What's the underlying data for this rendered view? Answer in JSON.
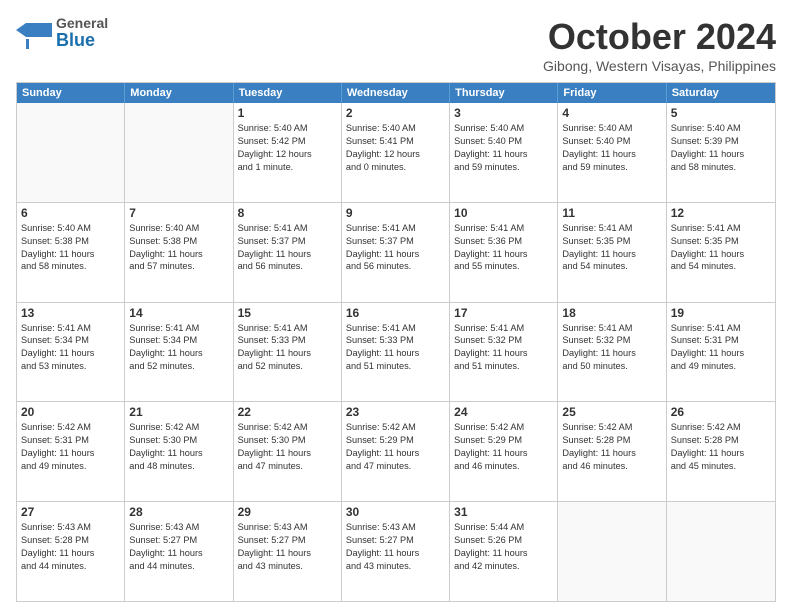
{
  "header": {
    "logo_general": "General",
    "logo_blue": "Blue",
    "month_title": "October 2024",
    "location": "Gibong, Western Visayas, Philippines"
  },
  "days_of_week": [
    "Sunday",
    "Monday",
    "Tuesday",
    "Wednesday",
    "Thursday",
    "Friday",
    "Saturday"
  ],
  "weeks": [
    [
      {
        "day": "",
        "lines": [],
        "empty": true
      },
      {
        "day": "",
        "lines": [],
        "empty": true
      },
      {
        "day": "1",
        "lines": [
          "Sunrise: 5:40 AM",
          "Sunset: 5:42 PM",
          "Daylight: 12 hours",
          "and 1 minute."
        ],
        "empty": false
      },
      {
        "day": "2",
        "lines": [
          "Sunrise: 5:40 AM",
          "Sunset: 5:41 PM",
          "Daylight: 12 hours",
          "and 0 minutes."
        ],
        "empty": false
      },
      {
        "day": "3",
        "lines": [
          "Sunrise: 5:40 AM",
          "Sunset: 5:40 PM",
          "Daylight: 11 hours",
          "and 59 minutes."
        ],
        "empty": false
      },
      {
        "day": "4",
        "lines": [
          "Sunrise: 5:40 AM",
          "Sunset: 5:40 PM",
          "Daylight: 11 hours",
          "and 59 minutes."
        ],
        "empty": false
      },
      {
        "day": "5",
        "lines": [
          "Sunrise: 5:40 AM",
          "Sunset: 5:39 PM",
          "Daylight: 11 hours",
          "and 58 minutes."
        ],
        "empty": false
      }
    ],
    [
      {
        "day": "6",
        "lines": [
          "Sunrise: 5:40 AM",
          "Sunset: 5:38 PM",
          "Daylight: 11 hours",
          "and 58 minutes."
        ],
        "empty": false
      },
      {
        "day": "7",
        "lines": [
          "Sunrise: 5:40 AM",
          "Sunset: 5:38 PM",
          "Daylight: 11 hours",
          "and 57 minutes."
        ],
        "empty": false
      },
      {
        "day": "8",
        "lines": [
          "Sunrise: 5:41 AM",
          "Sunset: 5:37 PM",
          "Daylight: 11 hours",
          "and 56 minutes."
        ],
        "empty": false
      },
      {
        "day": "9",
        "lines": [
          "Sunrise: 5:41 AM",
          "Sunset: 5:37 PM",
          "Daylight: 11 hours",
          "and 56 minutes."
        ],
        "empty": false
      },
      {
        "day": "10",
        "lines": [
          "Sunrise: 5:41 AM",
          "Sunset: 5:36 PM",
          "Daylight: 11 hours",
          "and 55 minutes."
        ],
        "empty": false
      },
      {
        "day": "11",
        "lines": [
          "Sunrise: 5:41 AM",
          "Sunset: 5:35 PM",
          "Daylight: 11 hours",
          "and 54 minutes."
        ],
        "empty": false
      },
      {
        "day": "12",
        "lines": [
          "Sunrise: 5:41 AM",
          "Sunset: 5:35 PM",
          "Daylight: 11 hours",
          "and 54 minutes."
        ],
        "empty": false
      }
    ],
    [
      {
        "day": "13",
        "lines": [
          "Sunrise: 5:41 AM",
          "Sunset: 5:34 PM",
          "Daylight: 11 hours",
          "and 53 minutes."
        ],
        "empty": false
      },
      {
        "day": "14",
        "lines": [
          "Sunrise: 5:41 AM",
          "Sunset: 5:34 PM",
          "Daylight: 11 hours",
          "and 52 minutes."
        ],
        "empty": false
      },
      {
        "day": "15",
        "lines": [
          "Sunrise: 5:41 AM",
          "Sunset: 5:33 PM",
          "Daylight: 11 hours",
          "and 52 minutes."
        ],
        "empty": false
      },
      {
        "day": "16",
        "lines": [
          "Sunrise: 5:41 AM",
          "Sunset: 5:33 PM",
          "Daylight: 11 hours",
          "and 51 minutes."
        ],
        "empty": false
      },
      {
        "day": "17",
        "lines": [
          "Sunrise: 5:41 AM",
          "Sunset: 5:32 PM",
          "Daylight: 11 hours",
          "and 51 minutes."
        ],
        "empty": false
      },
      {
        "day": "18",
        "lines": [
          "Sunrise: 5:41 AM",
          "Sunset: 5:32 PM",
          "Daylight: 11 hours",
          "and 50 minutes."
        ],
        "empty": false
      },
      {
        "day": "19",
        "lines": [
          "Sunrise: 5:41 AM",
          "Sunset: 5:31 PM",
          "Daylight: 11 hours",
          "and 49 minutes."
        ],
        "empty": false
      }
    ],
    [
      {
        "day": "20",
        "lines": [
          "Sunrise: 5:42 AM",
          "Sunset: 5:31 PM",
          "Daylight: 11 hours",
          "and 49 minutes."
        ],
        "empty": false
      },
      {
        "day": "21",
        "lines": [
          "Sunrise: 5:42 AM",
          "Sunset: 5:30 PM",
          "Daylight: 11 hours",
          "and 48 minutes."
        ],
        "empty": false
      },
      {
        "day": "22",
        "lines": [
          "Sunrise: 5:42 AM",
          "Sunset: 5:30 PM",
          "Daylight: 11 hours",
          "and 47 minutes."
        ],
        "empty": false
      },
      {
        "day": "23",
        "lines": [
          "Sunrise: 5:42 AM",
          "Sunset: 5:29 PM",
          "Daylight: 11 hours",
          "and 47 minutes."
        ],
        "empty": false
      },
      {
        "day": "24",
        "lines": [
          "Sunrise: 5:42 AM",
          "Sunset: 5:29 PM",
          "Daylight: 11 hours",
          "and 46 minutes."
        ],
        "empty": false
      },
      {
        "day": "25",
        "lines": [
          "Sunrise: 5:42 AM",
          "Sunset: 5:28 PM",
          "Daylight: 11 hours",
          "and 46 minutes."
        ],
        "empty": false
      },
      {
        "day": "26",
        "lines": [
          "Sunrise: 5:42 AM",
          "Sunset: 5:28 PM",
          "Daylight: 11 hours",
          "and 45 minutes."
        ],
        "empty": false
      }
    ],
    [
      {
        "day": "27",
        "lines": [
          "Sunrise: 5:43 AM",
          "Sunset: 5:28 PM",
          "Daylight: 11 hours",
          "and 44 minutes."
        ],
        "empty": false
      },
      {
        "day": "28",
        "lines": [
          "Sunrise: 5:43 AM",
          "Sunset: 5:27 PM",
          "Daylight: 11 hours",
          "and 44 minutes."
        ],
        "empty": false
      },
      {
        "day": "29",
        "lines": [
          "Sunrise: 5:43 AM",
          "Sunset: 5:27 PM",
          "Daylight: 11 hours",
          "and 43 minutes."
        ],
        "empty": false
      },
      {
        "day": "30",
        "lines": [
          "Sunrise: 5:43 AM",
          "Sunset: 5:27 PM",
          "Daylight: 11 hours",
          "and 43 minutes."
        ],
        "empty": false
      },
      {
        "day": "31",
        "lines": [
          "Sunrise: 5:44 AM",
          "Sunset: 5:26 PM",
          "Daylight: 11 hours",
          "and 42 minutes."
        ],
        "empty": false
      },
      {
        "day": "",
        "lines": [],
        "empty": true
      },
      {
        "day": "",
        "lines": [],
        "empty": true
      }
    ]
  ]
}
